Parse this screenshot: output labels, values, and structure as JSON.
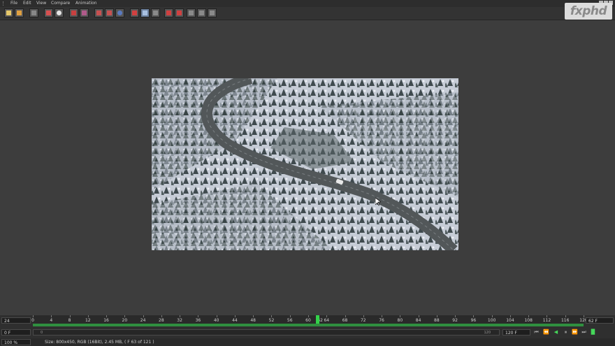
{
  "menu": [
    "File",
    "Edit",
    "View",
    "Compare",
    "Animation"
  ],
  "logo": {
    "text": "fxphd"
  },
  "toolbar": {
    "icons": [
      "open-icon",
      "save-icon",
      "clear-icon",
      "crop-icon",
      "color-picker-icon",
      "red-channel-icon",
      "compare-icon",
      "layout-single-icon",
      "layout-double-icon",
      "color-pick-icon",
      "text-overlay-icon",
      "grid-icon",
      "list-icon",
      "split-icon",
      "mark-a-icon",
      "mark-b-icon",
      "mix-icon",
      "filter-icon",
      "adjust-icon"
    ],
    "active_index": 11
  },
  "viewer": {
    "alt": "snowy forest road aerial render"
  },
  "timeline": {
    "current_frame_left": "24",
    "start_field": "0 F",
    "zoom": "100 %",
    "ruler_ticks": [
      "0",
      "4",
      "8",
      "12",
      "16",
      "20",
      "24",
      "28",
      "32",
      "36",
      "40",
      "44",
      "48",
      "52",
      "56",
      "60",
      "62",
      "64",
      "68",
      "72",
      "76",
      "80",
      "84",
      "88",
      "92",
      "96",
      "100",
      "104",
      "108",
      "112",
      "116",
      "120"
    ],
    "playhead_frame": 62,
    "range_start": 0,
    "range_end": 120,
    "end_field": "120 F",
    "current_frame_right": "62 F",
    "scroll_start": "0",
    "scroll_end": "120"
  },
  "status": {
    "text": "Size: 800x450, RGB (16Bit), 2.45 MB,  ( F 63 of 121 )"
  }
}
